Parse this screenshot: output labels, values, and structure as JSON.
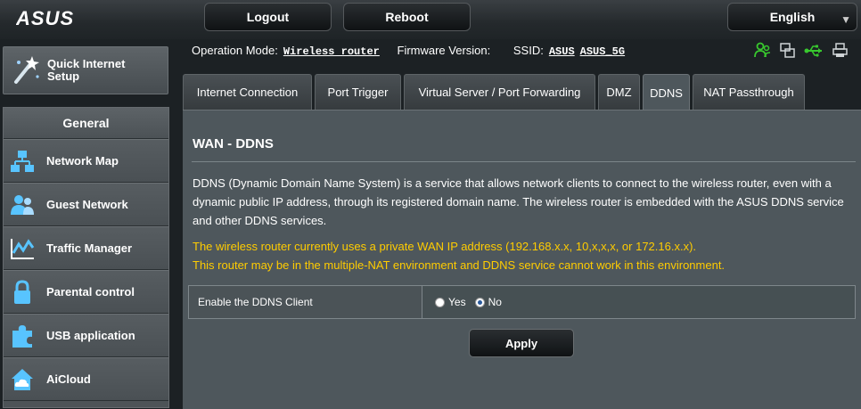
{
  "header": {
    "brand": "ASUS",
    "logout_label": "Logout",
    "reboot_label": "Reboot",
    "language_label": "English"
  },
  "sidebar": {
    "quick_setup_label": "Quick Internet Setup",
    "section_title": "General",
    "items": [
      {
        "label": "Network Map",
        "icon": "network-map-icon"
      },
      {
        "label": "Guest Network",
        "icon": "guest-network-icon"
      },
      {
        "label": "Traffic Manager",
        "icon": "traffic-manager-icon"
      },
      {
        "label": "Parental control",
        "icon": "lock-icon"
      },
      {
        "label": "USB application",
        "icon": "puzzle-icon"
      },
      {
        "label": "AiCloud",
        "icon": "cloud-icon"
      }
    ]
  },
  "status": {
    "operation_mode_label": "Operation Mode:",
    "operation_mode_value": "Wireless router",
    "firmware_label": "Firmware Version:",
    "firmware_value": "",
    "ssid_label": "SSID:",
    "ssid_values": [
      "ASUS",
      "ASUS_5G"
    ],
    "icons": [
      "clients-icon",
      "multi-device-icon",
      "usb-icon",
      "printer-icon"
    ]
  },
  "tabs": [
    {
      "label": "Internet Connection",
      "active": false
    },
    {
      "label": "Port Trigger",
      "active": false
    },
    {
      "label": "Virtual Server / Port Forwarding",
      "active": false
    },
    {
      "label": "DMZ",
      "active": false
    },
    {
      "label": "DDNS",
      "active": true
    },
    {
      "label": "NAT Passthrough",
      "active": false
    }
  ],
  "main": {
    "title": "WAN - DDNS",
    "description": "DDNS (Dynamic Domain Name System) is a service that allows network clients to connect to the wireless router, even with a dynamic public IP address, through its registered domain name. The wireless router is embedded with the ASUS DDNS service and other DDNS services.",
    "warning_line1": "The wireless router currently uses a private WAN IP address (192.168.x.x, 10,x,x,x, or 172.16.x.x).",
    "warning_line2": "This router may be in the multiple-NAT environment and DDNS service cannot work in this environment.",
    "ddns_client_label": "Enable the DDNS Client",
    "option_yes": "Yes",
    "option_no": "No",
    "selected": "No",
    "apply_label": "Apply"
  },
  "colors": {
    "warning": "#ffcc00",
    "status_icon_green": "#38c82e",
    "panel_bg": "#4e575c"
  }
}
